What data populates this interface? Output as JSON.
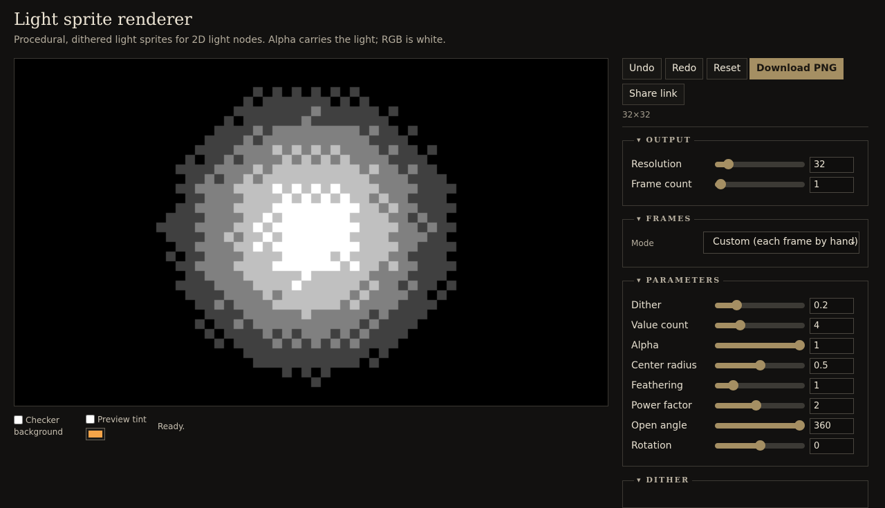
{
  "header": {
    "title": "Light sprite renderer",
    "subtitle": "Procedural, dithered light sprites for 2D light nodes. Alpha carries the light; RGB is white."
  },
  "preview": {
    "checker_label": "Checker background",
    "checker_checked": false,
    "tint_label": "Preview tint",
    "tint_checked": false,
    "tint_color": "#f5a449",
    "status": "Ready."
  },
  "toolbar": {
    "undo_label": "Undo",
    "redo_label": "Redo",
    "reset_label": "Reset",
    "download_label": "Download PNG",
    "share_label": "Share link",
    "dimensions": "32×32"
  },
  "sections": {
    "output": {
      "title": "▾ OUTPUT",
      "resolution": {
        "label": "Resolution",
        "value": "32",
        "level": 0.1
      },
      "frame_count": {
        "label": "Frame count",
        "value": "1",
        "level": 0.0
      }
    },
    "frames": {
      "title": "▾ FRAMES",
      "mode_label": "Mode",
      "mode_value": "Custom (each frame by hand)"
    },
    "parameters": {
      "title": "▾ PARAMETERS",
      "dither": {
        "label": "Dither",
        "value": "0.2",
        "level": 0.2
      },
      "value_count": {
        "label": "Value count",
        "value": "4",
        "level": 0.25
      },
      "alpha": {
        "label": "Alpha",
        "value": "1",
        "level": 1.0
      },
      "center_radius": {
        "label": "Center radius",
        "value": "0.5",
        "level": 0.5
      },
      "feathering": {
        "label": "Feathering",
        "value": "1",
        "level": 0.16
      },
      "power_factor": {
        "label": "Power factor",
        "value": "2",
        "level": 0.45
      },
      "open_angle": {
        "label": "Open angle",
        "value": "360",
        "level": 1.0
      },
      "rotation": {
        "label": "Rotation",
        "value": "0",
        "level": 0.5
      }
    },
    "dither": {
      "title": "▾ DITHER"
    }
  },
  "colors": {
    "accent": "#a58f63",
    "background": "#121110",
    "canvas": "#000000"
  }
}
